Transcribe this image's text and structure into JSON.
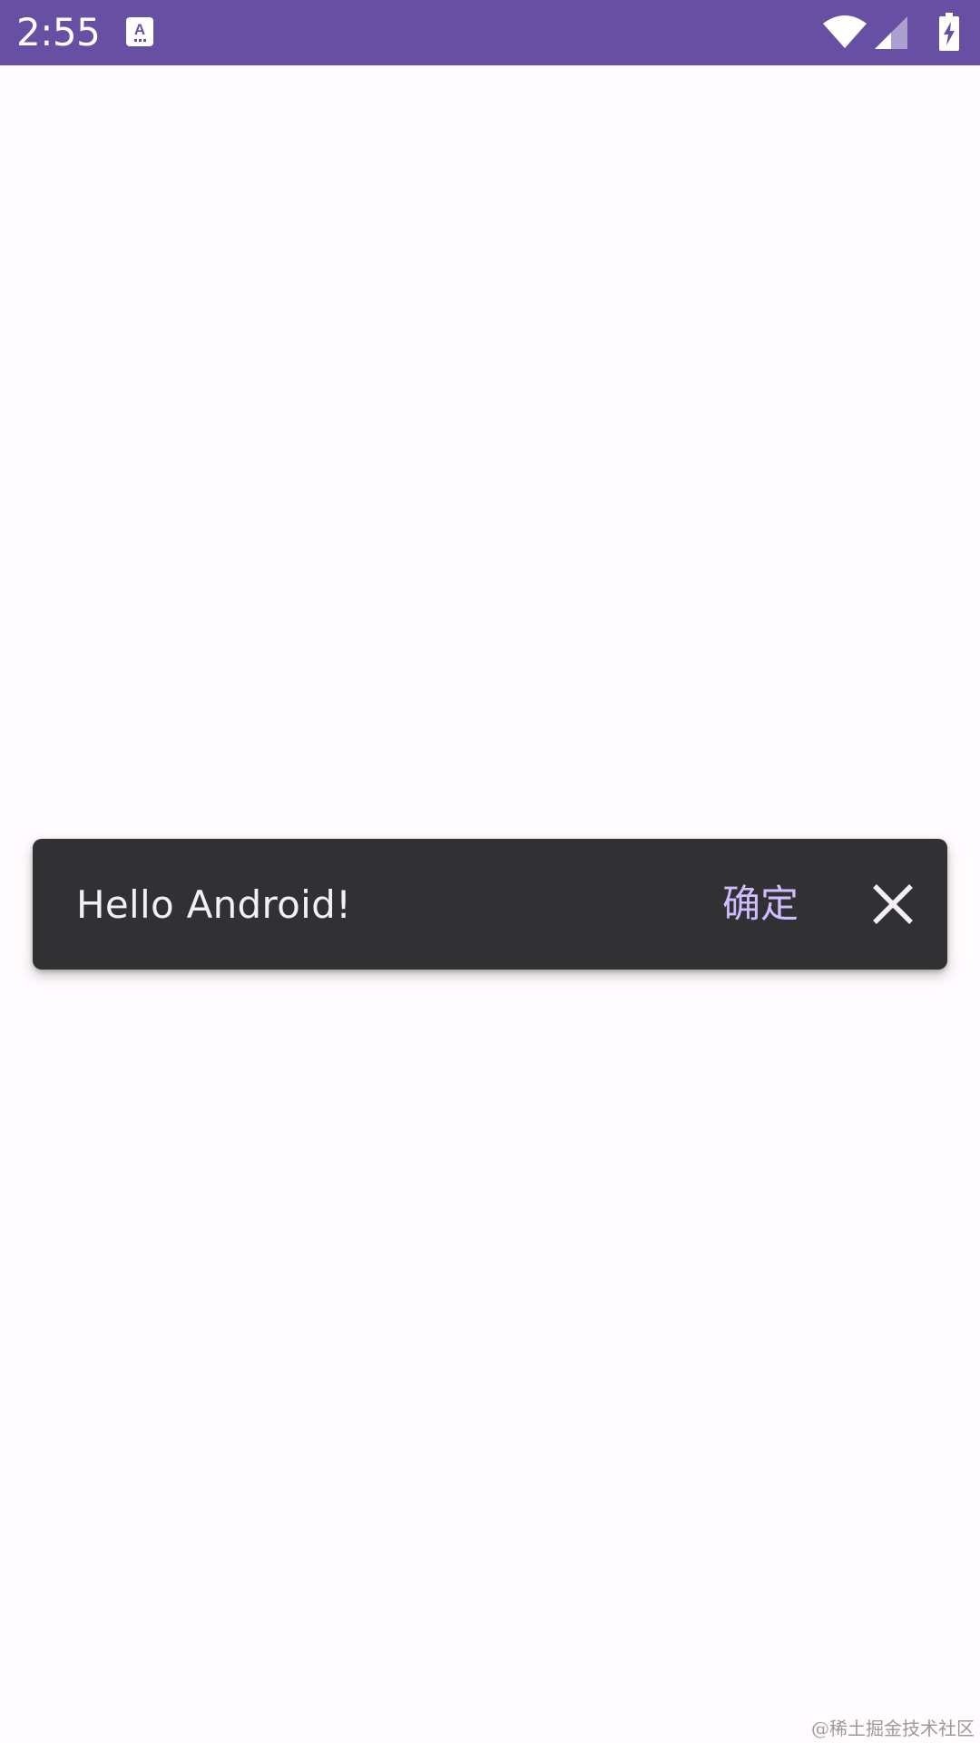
{
  "status_bar": {
    "time": "2:55",
    "app_icon": "keyboard-a-icon",
    "wifi": "wifi-icon",
    "signal": "signal-icon",
    "battery": "battery-charging-icon",
    "background_color": "#6750A4"
  },
  "snackbar": {
    "message": "Hello Android!",
    "action_label": "确定",
    "close_icon": "close-icon",
    "background_color": "#313033",
    "action_color": "#D0BCFF"
  },
  "watermark": {
    "text": "@稀土掘金技术社区"
  }
}
